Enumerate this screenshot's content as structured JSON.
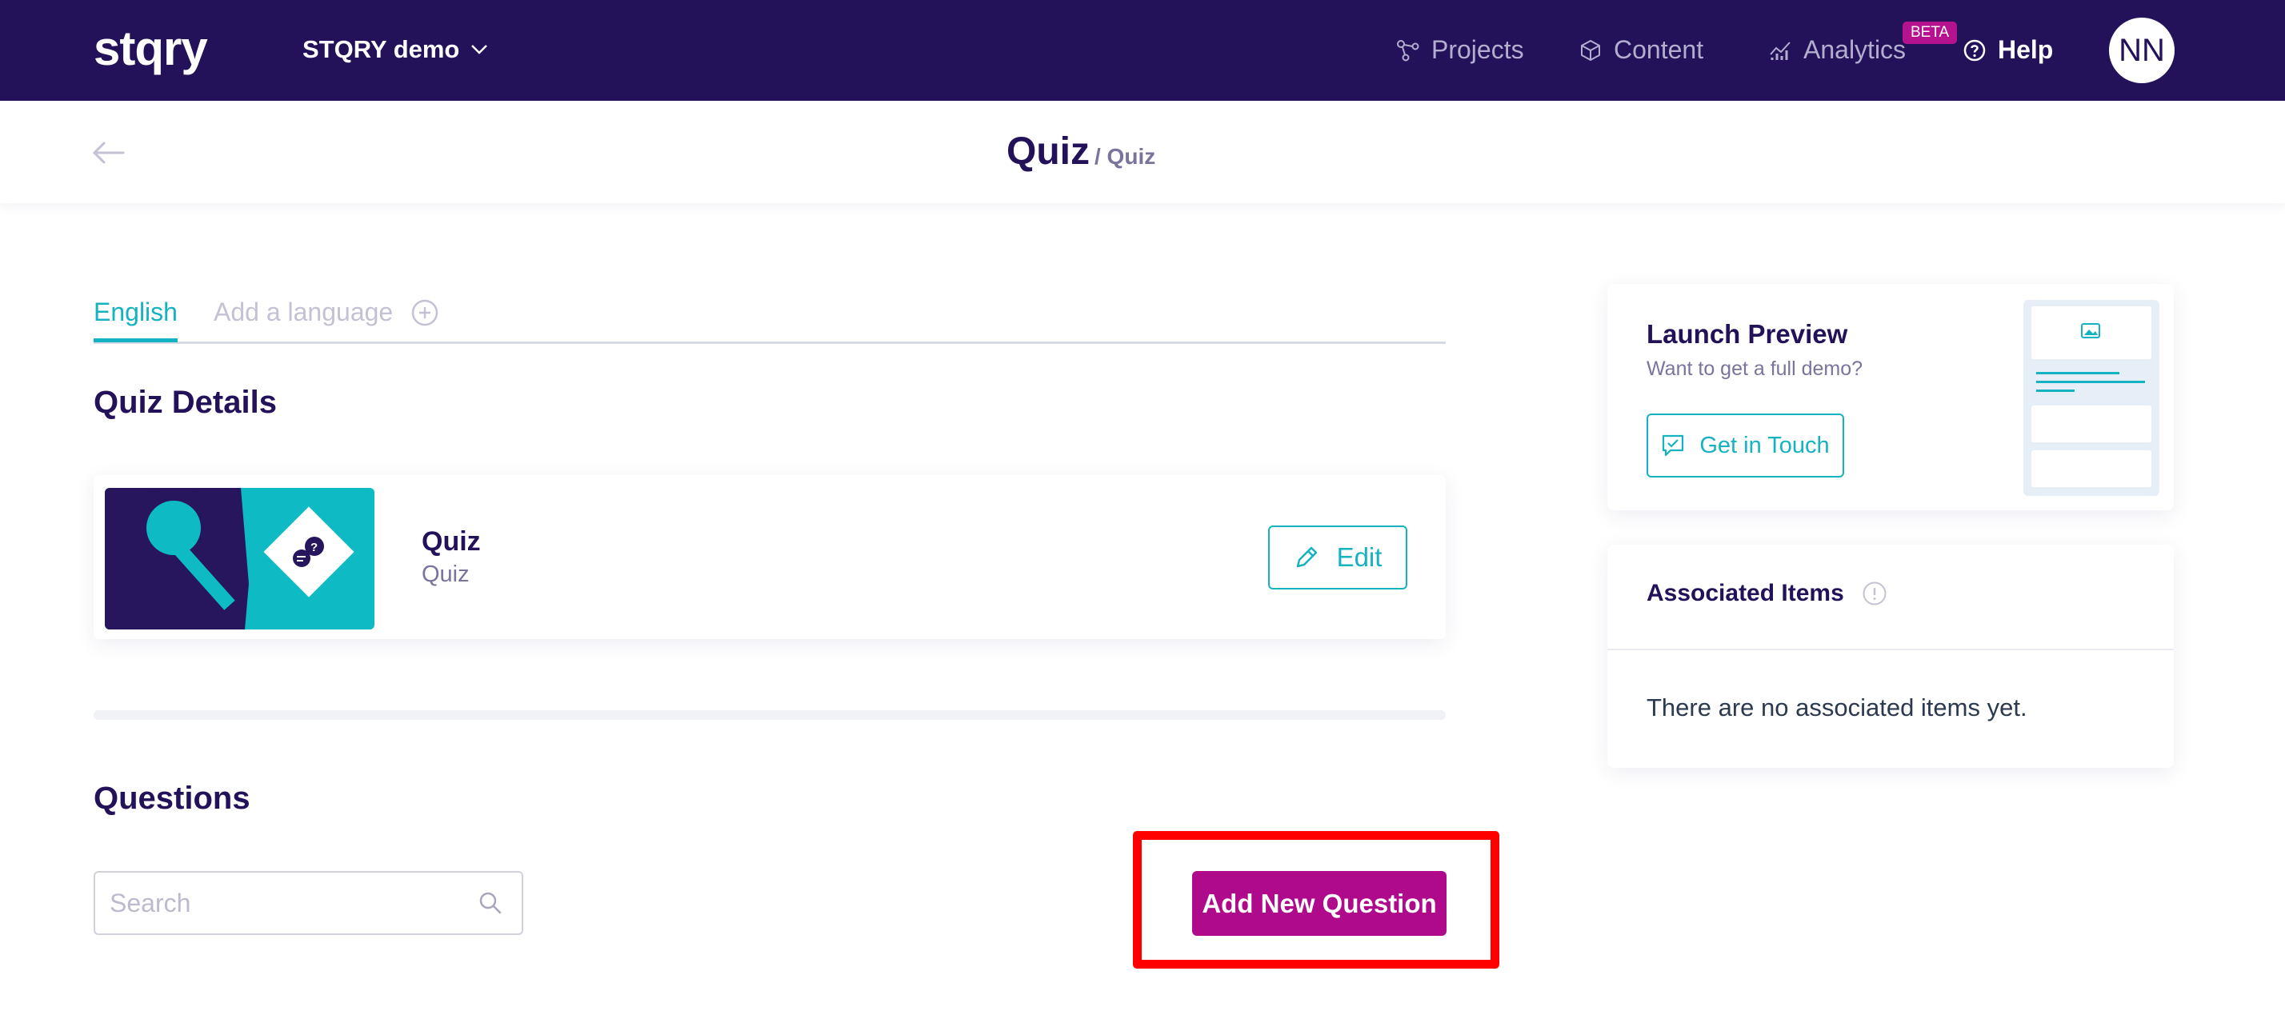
{
  "nav": {
    "logo": "stqry",
    "workspace": "STQRY demo",
    "projects": "Projects",
    "content": "Content",
    "analytics": "Analytics",
    "beta_badge": "BETA",
    "help": "Help",
    "avatar_initials": "NN"
  },
  "header": {
    "title": "Quiz",
    "breadcrumb": "/ Quiz"
  },
  "tabs": {
    "active": "English",
    "add": "Add a language"
  },
  "details": {
    "heading": "Quiz Details",
    "item_title": "Quiz",
    "item_type": "Quiz",
    "edit_label": "Edit"
  },
  "questions": {
    "heading": "Questions",
    "search_placeholder": "Search",
    "add_label": "Add New Question"
  },
  "preview": {
    "title": "Launch Preview",
    "subtitle": "Want to get a full demo?",
    "cta": "Get in Touch"
  },
  "associated": {
    "title": "Associated Items",
    "empty": "There are no associated items yet."
  },
  "colors": {
    "nav_bg": "#231259",
    "accent_teal": "#15b3c1",
    "accent_magenta": "#af0a8b",
    "highlight_red": "#ff0000"
  }
}
